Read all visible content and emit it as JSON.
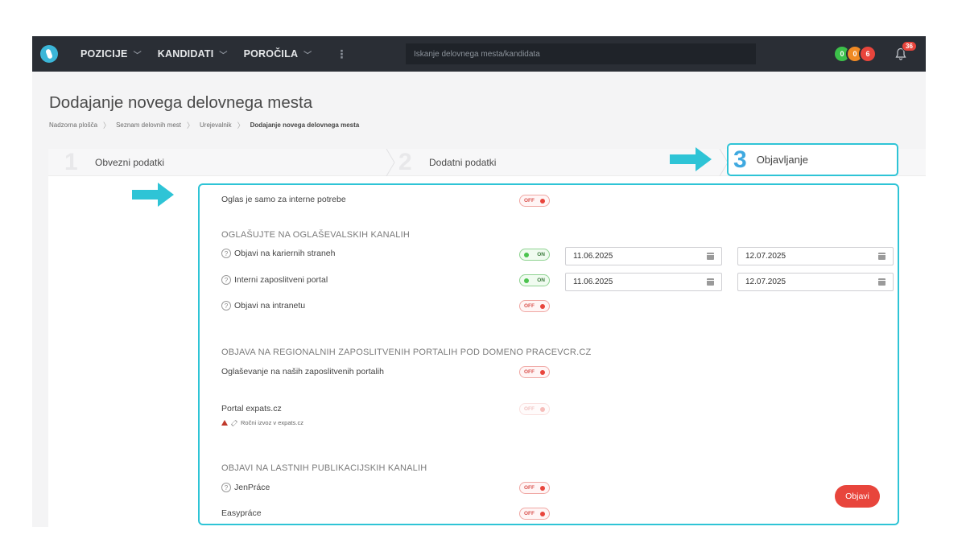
{
  "nav": {
    "items": [
      {
        "label": "POZICIJE"
      },
      {
        "label": "KANDIDATI"
      },
      {
        "label": "POROČILA"
      }
    ],
    "more_glyph": "⋮",
    "search_placeholder": "Iskanje delovnega mesta/kandidata",
    "badges": [
      {
        "value": "0",
        "color": "#3cc04a"
      },
      {
        "value": "0",
        "color": "#f08a24"
      },
      {
        "value": "6",
        "color": "#e8453c"
      }
    ],
    "notifications": "36"
  },
  "page": {
    "title": "Dodajanje novega delovnega mesta",
    "breadcrumb": [
      "Nadzorna plošča",
      "Seznam delovnih mest",
      "Urejevalnik",
      "Dodajanje novega delovnega mesta"
    ]
  },
  "steps": [
    {
      "num": "1",
      "label": "Obvezni podatki"
    },
    {
      "num": "2",
      "label": "Dodatni podatki"
    },
    {
      "num": "3",
      "label": "Objavljanje"
    }
  ],
  "form": {
    "internal_only": {
      "label": "Oglas je samo za interne potrebe",
      "state": "OFF"
    },
    "section1": "OGLAŠUJTE NA OGLAŠEVALSKIH KANALIH",
    "career_pages": {
      "label": "Objavi na kariernih straneh",
      "state": "ON",
      "from": "11.06.2025",
      "to": "12.07.2025"
    },
    "internal_portal": {
      "label": "Interni zaposlitveni portal",
      "state": "ON",
      "from": "11.06.2025",
      "to": "12.07.2025"
    },
    "intranet": {
      "label": "Objavi na intranetu",
      "state": "OFF"
    },
    "section2": "OBJAVA NA REGIONALNIH ZAPOSLITVENIH PORTALIH POD DOMENO PRACEVCR.CZ",
    "our_portals": {
      "label": "Oglaševanje na naših zaposlitvenih portalih",
      "state": "OFF"
    },
    "expats": {
      "label": "Portal expats.cz",
      "state": "OFF",
      "note": "Ročni izvoz v expats.cz"
    },
    "section3": "OBJAVI NA LASTNIH PUBLIKACIJSKIH KANALIH",
    "jenprace": {
      "label": "JenPráce",
      "state": "OFF"
    },
    "easyprace": {
      "label": "Easypráce",
      "state": "OFF"
    },
    "help_glyph": "?",
    "publish_label": "Objavi"
  },
  "colors": {
    "accent": "#2ec4d6",
    "danger": "#e8453c",
    "success": "#4cc34f"
  }
}
